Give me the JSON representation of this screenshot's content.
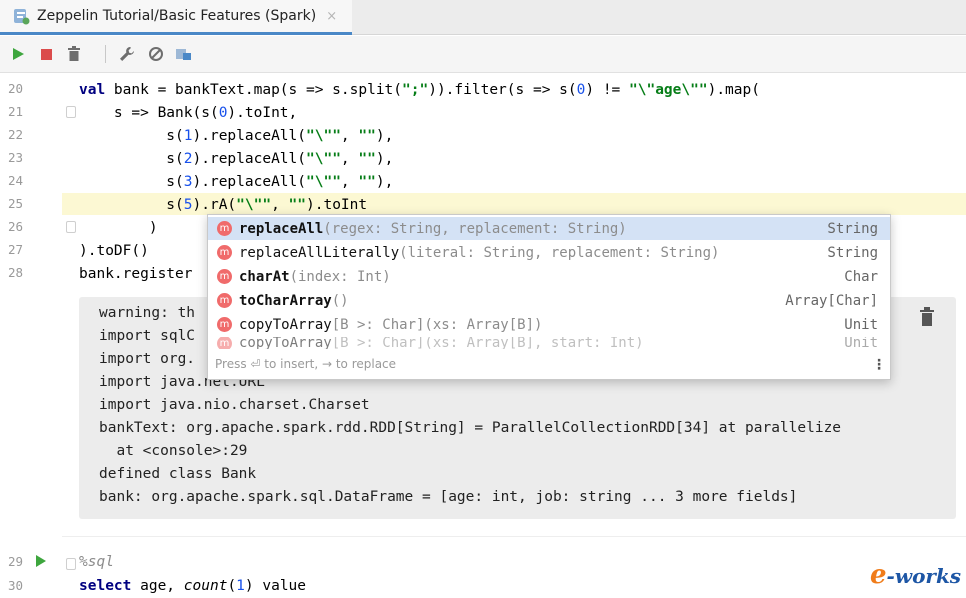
{
  "tab": {
    "title": "Zeppelin Tutorial/Basic Features (Spark)",
    "close": "×"
  },
  "toolbar": {
    "icons": [
      "run-icon",
      "stop-icon",
      "clear-icon",
      "settings-icon",
      "link-icon",
      "show-icon"
    ]
  },
  "colors": {
    "accent": "#4a88c7",
    "keyword": "#000080",
    "string": "#067d17",
    "number": "#1750eb",
    "method_icon": "#f06b6b"
  },
  "gutter": {
    "lines": [
      "20",
      "21",
      "22",
      "23",
      "24",
      "25",
      "26",
      "27",
      "28"
    ],
    "line29": "29",
    "line30": "30"
  },
  "code": {
    "l20": {
      "kw": "val",
      "a": " bank = bankText.map(s => s.split(",
      "s1": "\";\"",
      "b": ")).filter(s => s(",
      "n1": "0",
      "c": ") != ",
      "s2": "\"\\\"age\\\"\"",
      "d": ").map("
    },
    "l21": {
      "a": "    s => Bank(s(",
      "n": "0",
      "b": ").toInt,"
    },
    "l22": {
      "a": "          s(",
      "n": "1",
      "b": ").replaceAll(",
      "s1": "\"\\\"\"",
      "c": ", ",
      "s2": "\"\"",
      "d": "),"
    },
    "l23": {
      "a": "          s(",
      "n": "2",
      "b": ").replaceAll(",
      "s1": "\"\\\"\"",
      "c": ", ",
      "s2": "\"\"",
      "d": "),"
    },
    "l24": {
      "a": "          s(",
      "n": "3",
      "b": ").replaceAll(",
      "s1": "\"\\\"\"",
      "c": ", ",
      "s2": "\"\"",
      "d": "),"
    },
    "l25": {
      "a": "          s(",
      "n": "5",
      "b": ").rA(",
      "s1": "\"\\\"\"",
      "c": ", ",
      "s2": "\"\"",
      "d": ").toInt"
    },
    "l26": "        )",
    "l27": ").toDF()",
    "l28": "bank.register"
  },
  "output": {
    "lines": [
      "warning: th",
      "import sqlC",
      "import org.",
      "import java.net.URL",
      "import java.nio.charset.Charset",
      "bankText: org.apache.spark.rdd.RDD[String] = ParallelCollectionRDD[34] at parallelize",
      "  at <console>:29",
      "defined class Bank",
      "bank: org.apache.spark.sql.DataFrame = [age: int, job: string ... 3 more fields]"
    ]
  },
  "completion": {
    "items": [
      {
        "hl": "replaceAll",
        "rest": "",
        "params": "(regex: String, replacement: String)",
        "type": "String",
        "bold": true
      },
      {
        "hl": "replaceAll",
        "rest": "Literally",
        "params": "(literal: String, replacement: String)",
        "type": "String",
        "bold": false
      },
      {
        "hl": "charAt",
        "rest": "",
        "params": "(index: Int)",
        "type": "Char",
        "bold": true
      },
      {
        "hl": "toCharArray",
        "rest": "",
        "params": "()",
        "type": "Array[Char]",
        "bold": true
      },
      {
        "hl": "copyToArray",
        "rest": "",
        "params": "[B >: Char](xs: Array[B])",
        "type": "Unit",
        "bold": false
      },
      {
        "hl": "copyToArray",
        "rest": "",
        "params": "[B >: Char](xs: Array[B], start: Int)",
        "type": "Unit",
        "bold": false
      }
    ],
    "m": "m",
    "hint": "Press ⏎ to insert, → to replace",
    "more": "⋮"
  },
  "para2": {
    "l29": "%sql",
    "l30_kw": "select",
    "l30_a": " age, ",
    "l30_it": "count",
    "l30_b": "(",
    "l30_n": "1",
    "l30_c": ") value"
  },
  "watermark": {
    "e": "e",
    "text": "-works"
  }
}
